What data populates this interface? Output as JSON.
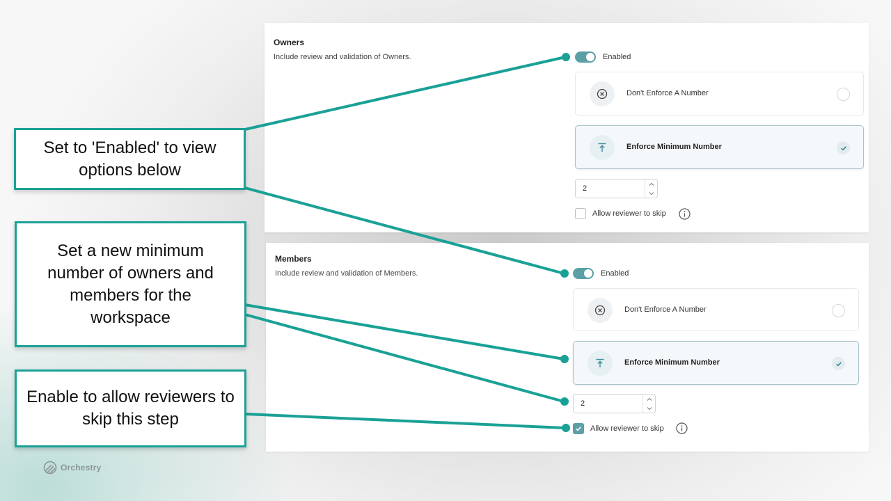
{
  "owners": {
    "title": "Owners",
    "description": "Include review and validation of Owners.",
    "toggle_label": "Enabled",
    "options": [
      {
        "label": "Don't Enforce A Number",
        "icon": "circle-x-icon",
        "selected": false
      },
      {
        "label": "Enforce Minimum Number",
        "icon": "arrow-up-to-line-icon",
        "selected": true
      }
    ],
    "min_value": "2",
    "skip_label": "Allow reviewer to skip",
    "skip_checked": false
  },
  "members": {
    "title": "Members",
    "description": "Include review and validation of Members.",
    "toggle_label": "Enabled",
    "options": [
      {
        "label": "Don't Enforce A Number",
        "icon": "circle-x-icon",
        "selected": false
      },
      {
        "label": "Enforce Minimum Number",
        "icon": "arrow-up-to-line-icon",
        "selected": true
      }
    ],
    "min_value": "2",
    "skip_label": "Allow reviewer to skip",
    "skip_checked": true
  },
  "callouts": {
    "enabled": "Set to 'Enabled' to view options below",
    "minimum": "Set a new minimum number of owners and members for the workspace",
    "skip": "Enable to allow reviewers to skip this step"
  },
  "brand": {
    "name": "Orchestry",
    "accent_color": "#1aa196",
    "toggle_color": "#5aa0a6"
  }
}
